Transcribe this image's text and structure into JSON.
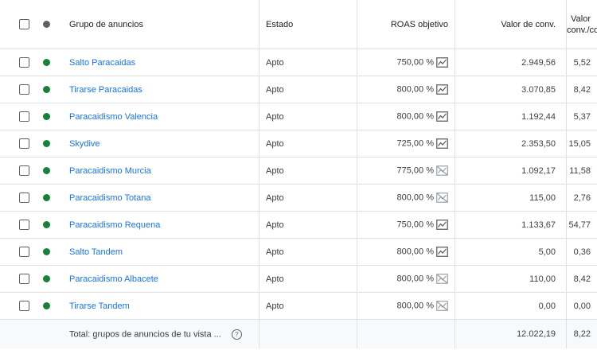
{
  "header": {
    "ad_group": "Grupo de anuncios",
    "status": "Estado",
    "roas": "ROAS objetivo",
    "conv_value": "Valor de conv.",
    "ratio_line1": "Valor",
    "ratio_line2": "conv./coste"
  },
  "colors": {
    "active_dot": "#188038",
    "header_dot": "#5f6368",
    "link": "#1a73e8"
  },
  "rows": [
    {
      "name": "Salto Paracaidas",
      "status": "Apto",
      "roas": "750,00 %",
      "trend": "chart-icon",
      "conv_value": "2.949,56",
      "ratio": "5,52"
    },
    {
      "name": "Tirarse Paracaidas",
      "status": "Apto",
      "roas": "800,00 %",
      "trend": "chart-icon",
      "conv_value": "3.070,85",
      "ratio": "8,42"
    },
    {
      "name": "Paracaidismo Valencia",
      "status": "Apto",
      "roas": "800,00 %",
      "trend": "chart-icon",
      "conv_value": "1.192,44",
      "ratio": "5,37"
    },
    {
      "name": "Skydive",
      "status": "Apto",
      "roas": "725,00 %",
      "trend": "chart-icon",
      "conv_value": "2.353,50",
      "ratio": "15,05"
    },
    {
      "name": "Paracaidismo Murcia",
      "status": "Apto",
      "roas": "775,00 %",
      "trend": "chart-off-icon",
      "conv_value": "1.092,17",
      "ratio": "11,58"
    },
    {
      "name": "Paracaidismo Totana",
      "status": "Apto",
      "roas": "800,00 %",
      "trend": "chart-off-icon",
      "conv_value": "115,00",
      "ratio": "2,76"
    },
    {
      "name": "Paracaidismo Requena",
      "status": "Apto",
      "roas": "750,00 %",
      "trend": "chart-icon",
      "conv_value": "1.133,67",
      "ratio": "54,77"
    },
    {
      "name": "Salto Tandem",
      "status": "Apto",
      "roas": "800,00 %",
      "trend": "chart-icon",
      "conv_value": "5,00",
      "ratio": "0,36"
    },
    {
      "name": "Paracaidismo Albacete",
      "status": "Apto",
      "roas": "800,00 %",
      "trend": "chart-off-icon",
      "conv_value": "110,00",
      "ratio": "8,42"
    },
    {
      "name": "Tirarse Tandem",
      "status": "Apto",
      "roas": "800,00 %",
      "trend": "chart-off-icon",
      "conv_value": "0,00",
      "ratio": "0,00"
    }
  ],
  "total": {
    "label": "Total: grupos de anuncios de tu vista ...",
    "help_icon": "help-icon",
    "help_glyph": "?",
    "conv_value": "12.022,19",
    "ratio": "8,22"
  }
}
